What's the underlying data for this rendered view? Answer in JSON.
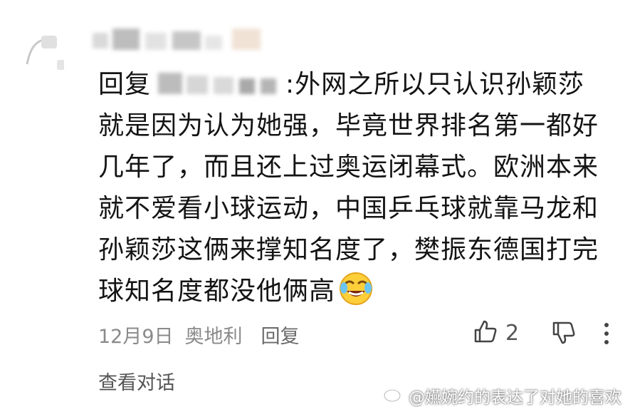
{
  "comment": {
    "reply_prefix": "回复",
    "text_after_mention": ":外网之所以只认识孙颖莎就是因为认为她强，毕竟世界排名第一都好几年了，而且还上过奥运闭幕式。欧洲本来就不爱看小球运动，中国乒乓球就靠马龙和孙颖莎这俩来撑知名度了，樊振东德国打完球知名度都没他俩高",
    "emoji": "crying-laughing-emoji"
  },
  "meta": {
    "date": "12月9日",
    "location": "奥地利",
    "reply_label": "回复"
  },
  "actions": {
    "like_count": "2",
    "like_icon": "thumbs-up-icon",
    "dislike_icon": "thumbs-down-icon",
    "more_icon": "more-vertical-icon"
  },
  "view_conversation": "查看对话",
  "watermark": {
    "text": "@嬿婉约的表达了对她的喜欢",
    "icon": "weibo-icon"
  }
}
